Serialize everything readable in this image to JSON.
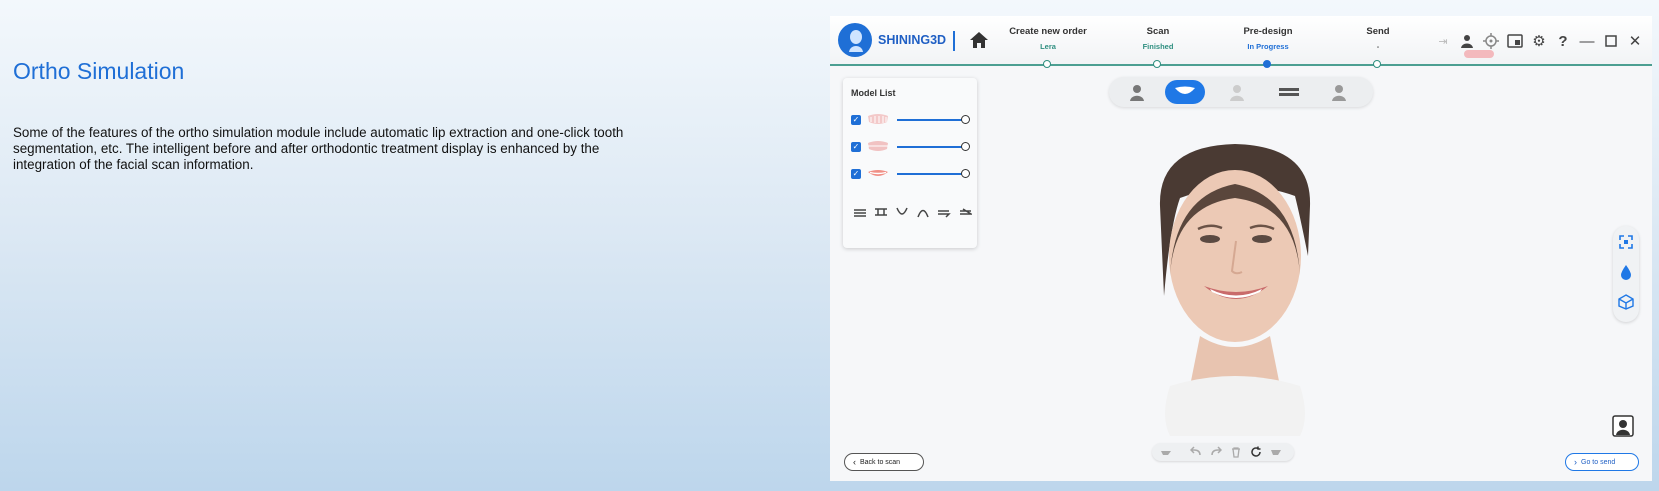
{
  "slide": {
    "title": "Ortho Simulation",
    "body": "Some of the features of the ortho simulation module include automatic lip extraction and one-click tooth segmentation, etc. The intelligent before and after orthodontic treatment display is enhanced by the integration of the facial scan information."
  },
  "app": {
    "brand": "SHINING3D",
    "steps": [
      {
        "title": "Create new order",
        "sub": "Lera",
        "sub_color": "#2f8f80"
      },
      {
        "title": "Scan",
        "sub": "Finished",
        "sub_color": "#2f8f80"
      },
      {
        "title": "Pre-design",
        "sub": "In Progress",
        "sub_color": "#1f6fd6"
      },
      {
        "title": "Send",
        "sub": "-",
        "sub_color": "#555555"
      }
    ],
    "model_list": {
      "title": "Model List",
      "items": [
        {
          "name": "upper-jaw",
          "checked": true,
          "level": 1.0
        },
        {
          "name": "lower-jaw",
          "checked": true,
          "level": 1.0
        },
        {
          "name": "lip",
          "checked": true,
          "level": 1.0
        }
      ]
    },
    "buttons": {
      "back": "Back to scan",
      "next": "Go to send"
    },
    "colors": {
      "accent": "#1f78e6",
      "progress": "#2f8f80"
    }
  }
}
